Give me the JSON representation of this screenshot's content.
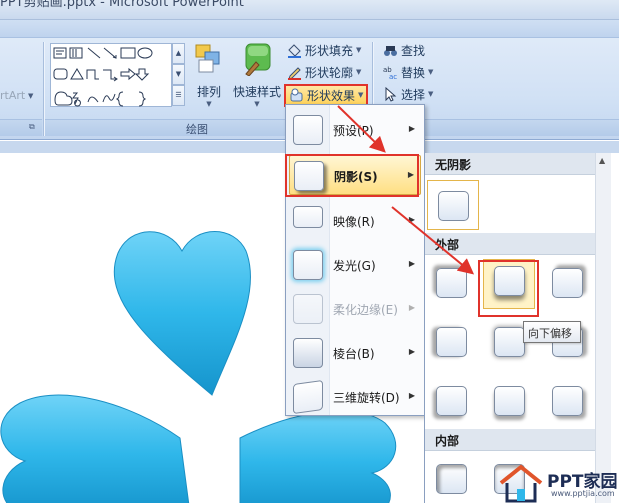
{
  "window": {
    "title": "PPT剪贴画.pptx - Microsoft PowerPoint"
  },
  "ribbon": {
    "wordart_label": "rtArt",
    "arrange_label": "排列",
    "quick_styles_label": "快速样式",
    "shape_fill_label": "形状填充",
    "shape_outline_label": "形状轮廓",
    "shape_effects_label": "形状效果",
    "find_label": "查找",
    "replace_label": "替换",
    "select_label": "选择",
    "drawing_group_label": "绘图"
  },
  "effects_menu": {
    "items": [
      {
        "label": "预设(P)",
        "enabled": true
      },
      {
        "label": "阴影(S)",
        "enabled": true
      },
      {
        "label": "映像(R)",
        "enabled": true
      },
      {
        "label": "发光(G)",
        "enabled": true
      },
      {
        "label": "柔化边缘(E)",
        "enabled": false
      },
      {
        "label": "棱台(B)",
        "enabled": true
      },
      {
        "label": "三维旋转(D)",
        "enabled": true
      }
    ],
    "selected_index": 1
  },
  "shadow_submenu": {
    "sections": {
      "none": "无阴影",
      "outer": "外部",
      "inner": "内部"
    },
    "selected_preset": "向下偏移",
    "tooltip": "向下偏移"
  },
  "watermark": {
    "brand": "PPT家园",
    "url": "www.pptjia.com"
  },
  "colors": {
    "accent_red": "#e0332b",
    "shape_blue": "#2fb7ea",
    "ribbon_bg": "#d1e1f5"
  }
}
